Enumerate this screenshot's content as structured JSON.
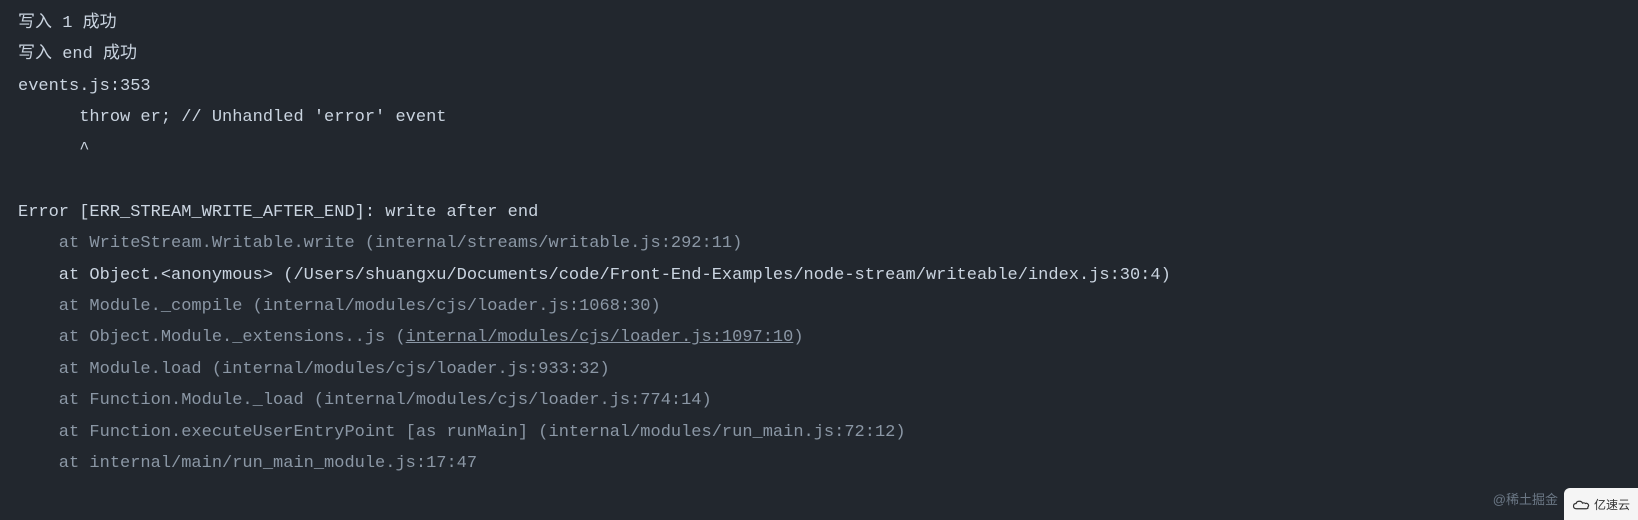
{
  "terminal": {
    "lines": [
      {
        "text": "写入 1 成功",
        "style": "bright"
      },
      {
        "text": "写入 end 成功",
        "style": "bright"
      },
      {
        "text": "events.js:353",
        "style": "bright"
      },
      {
        "text": "      throw er; // Unhandled 'error' event",
        "style": "bright"
      },
      {
        "text": "      ^",
        "style": "bright"
      },
      {
        "text": "",
        "style": "blank"
      },
      {
        "text": "Error [ERR_STREAM_WRITE_AFTER_END]: write after end",
        "style": "bright"
      },
      {
        "text": "    at WriteStream.Writable.write (internal/streams/writable.js:292:11)",
        "style": "dim"
      },
      {
        "text": "    at Object.<anonymous> (/Users/shuangxu/Documents/code/Front-End-Examples/node-stream/writeable/index.js:30:4)",
        "style": "bright"
      },
      {
        "text": "    at Module._compile (internal/modules/cjs/loader.js:1068:30)",
        "style": "dim"
      },
      {
        "prefix": "    at Object.Module._extensions..js (",
        "underlined": "internal/modules/cjs/loader.js:1097:10",
        "suffix": ")",
        "style": "dim"
      },
      {
        "text": "    at Module.load (internal/modules/cjs/loader.js:933:32)",
        "style": "dim"
      },
      {
        "text": "    at Function.Module._load (internal/modules/cjs/loader.js:774:14)",
        "style": "dim"
      },
      {
        "text": "    at Function.executeUserEntryPoint [as runMain] (internal/modules/run_main.js:72:12)",
        "style": "dim"
      },
      {
        "text": "    at internal/main/run_main_module.js:17:47",
        "style": "dim"
      }
    ]
  },
  "watermarks": {
    "left": "@稀土掘金",
    "right": "亿速云"
  }
}
